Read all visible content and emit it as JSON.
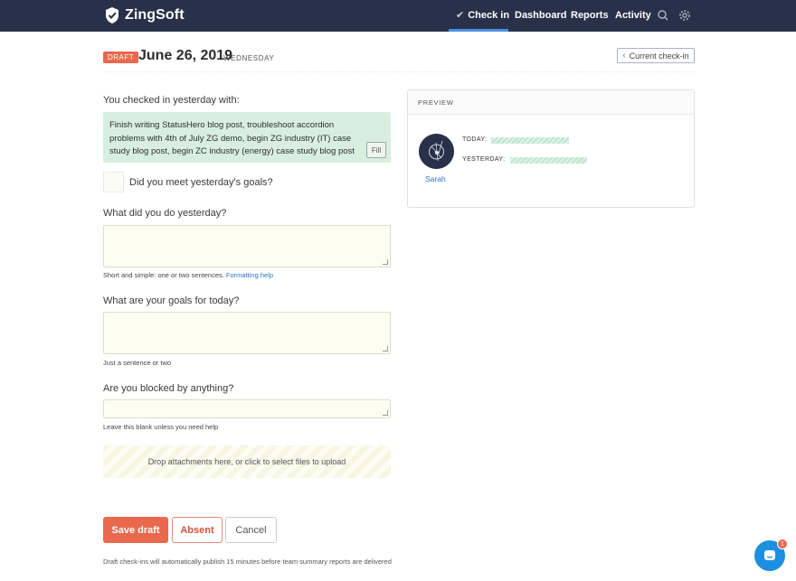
{
  "brand": {
    "name": "ZingSoft"
  },
  "nav": {
    "items": [
      {
        "label": "Check in",
        "active": true
      },
      {
        "label": "Dashboard"
      },
      {
        "label": "Reports"
      },
      {
        "label": "Activity"
      }
    ],
    "icons": [
      "search-icon",
      "gear-icon"
    ]
  },
  "header": {
    "badge": "DRAFT",
    "date": "June 26, 2019",
    "weekday": "WEDNESDAY",
    "current_checkin": "Current check-in"
  },
  "form": {
    "yesterday_label": "You checked in yesterday with:",
    "yesterday_text": "Finish writing StatusHero blog post, troubleshoot accordion problems with 4th of July ZG demo, begin ZG industry (IT) case study blog post, begin ZC industry (energy) case study blog post",
    "fill_label": "Fill",
    "met_goals_label": "Did you meet yesterday's goals?",
    "did_label": "What did you do yesterday?",
    "did_value": "",
    "did_help": "Short and simple: one or two sentences.",
    "formatting_help": "Formatting help",
    "goals_label": "What are your goals for today?",
    "goals_value": "",
    "goals_help": "Just a sentence or two",
    "blocked_label": "Are you blocked by anything?",
    "blocked_value": "",
    "blocked_help": "Leave this blank unless you need help",
    "dropzone": "Drop attachments here, or click to select files to upload"
  },
  "actions": {
    "save": "Save draft",
    "absent": "Absent",
    "cancel": "Cancel",
    "footer_note": "Draft check-ins will automatically publish 15 minutes before team summary reports are delivered"
  },
  "preview": {
    "title": "PREVIEW",
    "user_name": "Sarah",
    "today_label": "TODAY:",
    "yesterday_label": "YESTERDAY:"
  },
  "chat": {
    "badge": "1"
  },
  "colors": {
    "topbar": "#283149",
    "accent": "#e8694e",
    "link": "#2a74c6",
    "yesterday_bg": "#d8efdf"
  }
}
